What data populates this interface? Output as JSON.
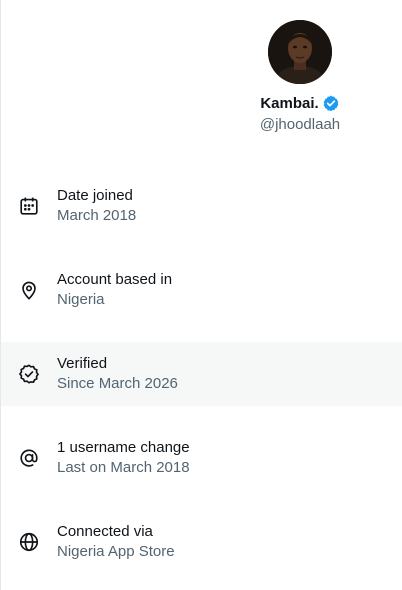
{
  "profile": {
    "display_name": "Kambai.",
    "handle": "@jhoodlaah",
    "avatar_icon": "avatar-photo",
    "verified_icon": "verified-badge-icon",
    "verified_color": "#1d9bf0"
  },
  "rows": [
    {
      "icon": "calendar-icon",
      "title": "Date joined",
      "subtitle": "March 2018"
    },
    {
      "icon": "location-pin-icon",
      "title": "Account based in",
      "subtitle": "Nigeria"
    },
    {
      "icon": "verified-outline-icon",
      "title": "Verified",
      "subtitle": "Since March 2026"
    },
    {
      "icon": "at-sign-icon",
      "title": "1 username change",
      "subtitle": "Last on March 2018"
    },
    {
      "icon": "globe-icon",
      "title": "Connected via",
      "subtitle": "Nigeria App Store"
    }
  ],
  "colors": {
    "text_primary": "#0f1419",
    "text_secondary": "#536471",
    "highlight_bg": "#f6f8f8"
  }
}
